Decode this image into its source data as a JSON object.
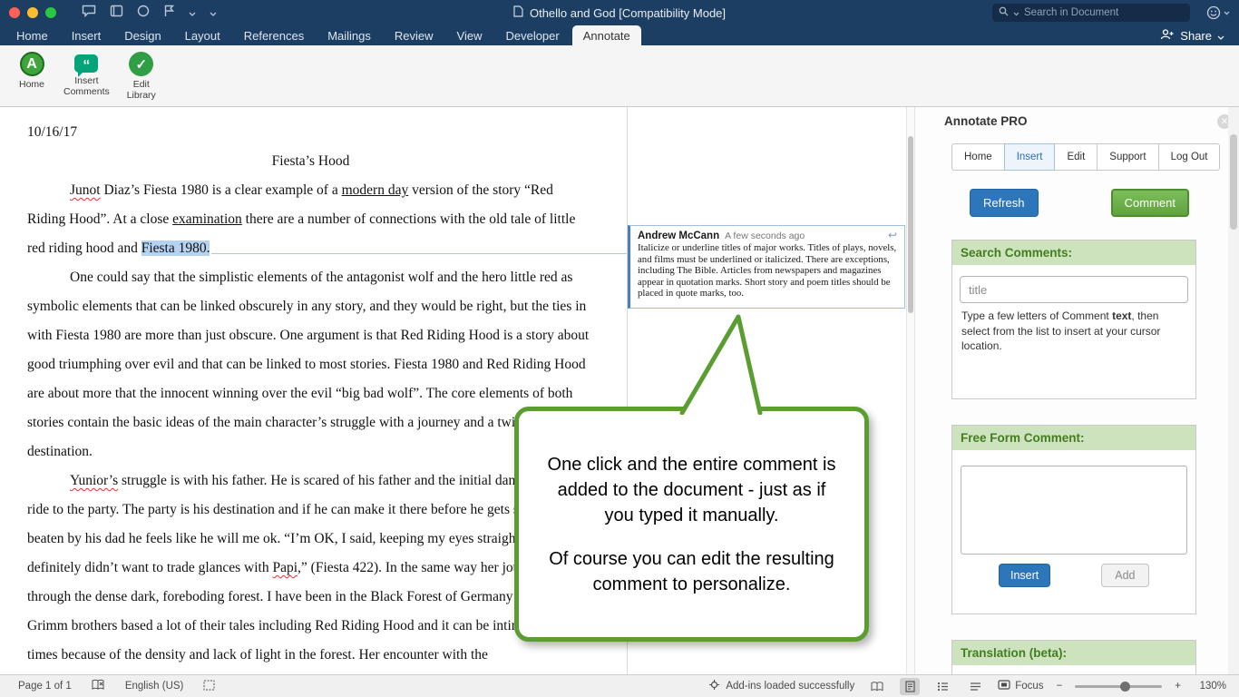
{
  "titlebar": {
    "title": "Othello and God [Compatibility Mode]",
    "search_placeholder": "Search in Document"
  },
  "menubar": {
    "tabs": [
      "Home",
      "Insert",
      "Design",
      "Layout",
      "References",
      "Mailings",
      "Review",
      "View",
      "Developer",
      "Annotate"
    ],
    "active_tab": "Annotate",
    "share_label": "Share"
  },
  "ribbon": {
    "home": "Home",
    "insert_comments_1": "Insert",
    "insert_comments_2": "Comments",
    "edit_library_1": "Edit",
    "edit_library_2": "Library"
  },
  "document": {
    "date": "10/16/17",
    "title": "Fiesta’s Hood",
    "p1": {
      "w1": "Junot",
      "t1": " Diaz’s Fiesta 1980 is a clear example of a ",
      "u1": "modern day",
      "t2": " version of the story “Red Riding Hood”. At a close ",
      "u2": "examination",
      "t3": " there are a number of connections with the old tale of little red riding hood and ",
      "sel": "Fiesta 1980."
    },
    "p2": "One could say that the simplistic elements of the antagonist wolf and the hero little red as symbolic elements that can be linked obscurely in any story, and they would be right, but the ties in with Fiesta 1980 are more than just obscure. One argument is that Red Riding Hood is a story about good triumphing over evil and that can be linked to most stories. Fiesta 1980 and Red Riding Hood are about more that the innocent winning over the evil “big bad wolf”. The core elements of both stories contain the basic ideas of the main character’s struggle with a journey and a twist at their destination.",
    "p3": {
      "w1": "Yunior’s",
      "t1": " struggle is with his father. He is scared of his father and the initial danger is the car ride to the party. The party is his destination and if he can make it there before he gets sick and gets beaten by his dad he feels like he will me ok. “I’m OK, I said, keeping my eyes straight ahead. I definitely didn’t want to trade glances with ",
      "w2": "Papi",
      "t2": ",” (Fiesta 422). In the same way her journey is through the dense dark, foreboding forest. I have been in the Black Forest of Germany where the Grimm brothers based a lot of their tales including Red Riding Hood and it can be intimidating at times because of the density and lack of light in the forest. Her encounter with the"
    }
  },
  "comment": {
    "author": "Andrew McCann",
    "time": "A few seconds ago",
    "text": "Italicize or underline titles of major works. Titles of plays, novels, and films must be underlined or italicized. There are exceptions, including The Bible. Articles from newspapers and magazines appear in quotation marks. Short story and poem titles should be placed in quote marks, too."
  },
  "callout": {
    "p1": "One click and the entire comment is added to the document - just as if you typed it manually.",
    "p2": "Of course you can edit the resulting comment to personalize."
  },
  "sidebar": {
    "title": "Annotate PRO",
    "tabs": [
      "Home",
      "Insert",
      "Edit",
      "Support",
      "Log Out"
    ],
    "active_tab": "Insert",
    "refresh_label": "Refresh",
    "comment_label": "Comment",
    "search_section": {
      "header": "Search Comments:",
      "placeholder": "title",
      "help_pre": "Type a few letters of Comment ",
      "help_bold": "text",
      "help_post": ", then select from the list to insert at your cursor location."
    },
    "freeform_section": {
      "header": "Free Form Comment:",
      "insert_label": "Insert",
      "add_label": "Add"
    },
    "translation_section": {
      "header": "Translation (beta):"
    }
  },
  "statusbar": {
    "page": "Page 1 of 1",
    "language": "English (US)",
    "addins": "Add-ins loaded successfully",
    "focus": "Focus",
    "zoom_out": "−",
    "zoom_in": "+",
    "zoom": "130%"
  },
  "icons": {
    "close_icon": "✕",
    "reply_icon": "↩",
    "logo_letter": "A",
    "quote_icon": "“",
    "check_icon": "✓"
  },
  "colors": {
    "titlebar_bg": "#1d3e63",
    "accent_blue": "#2d76b9",
    "callout_green": "#5a9e32",
    "comment_button_green": "#5fa23e",
    "section_header_bg": "#cde3bd",
    "section_header_text": "#447d21",
    "selection_highlight": "#b5d3f0",
    "comment_border_blue": "#4a81bd"
  }
}
